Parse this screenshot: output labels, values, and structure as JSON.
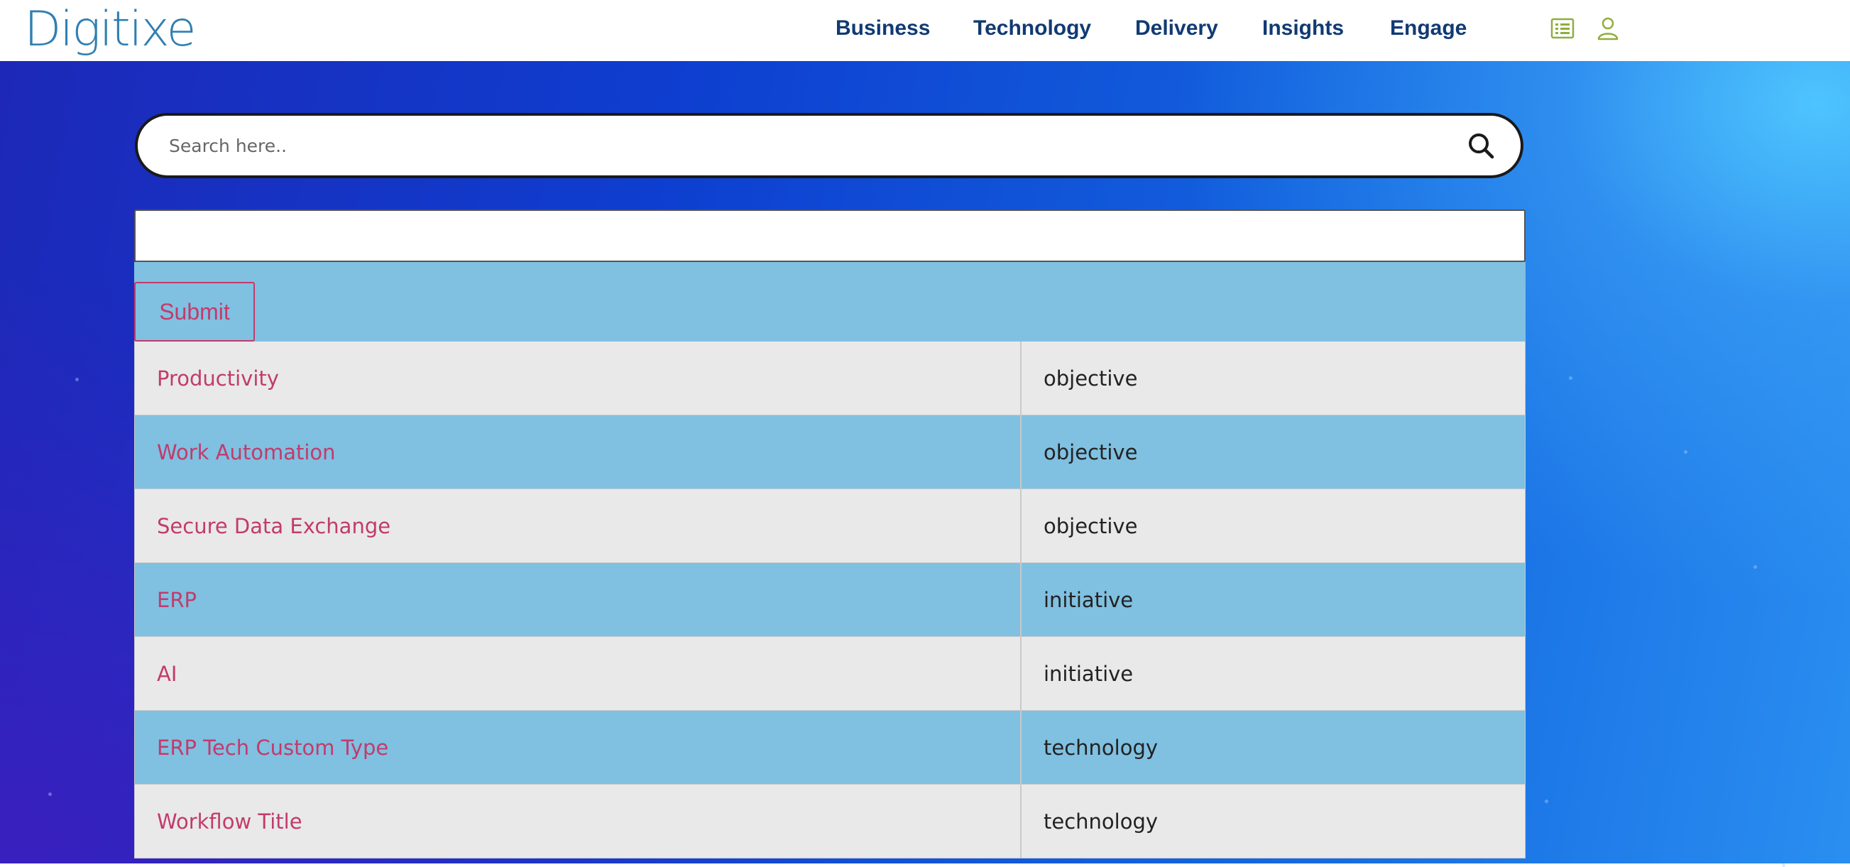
{
  "header": {
    "logo_text": "Digitixe",
    "nav": [
      {
        "label": "Business"
      },
      {
        "label": "Technology"
      },
      {
        "label": "Delivery"
      },
      {
        "label": "Insights"
      },
      {
        "label": "Engage"
      }
    ],
    "icons": [
      "list-icon",
      "user-icon"
    ],
    "icon_color": "#8fae3a",
    "nav_color": "#113a73"
  },
  "search": {
    "placeholder": "Search here..",
    "value": ""
  },
  "form": {
    "text_value": "",
    "submit_label": "Submit"
  },
  "results": [
    {
      "name": "Productivity",
      "type": "objective"
    },
    {
      "name": "Work Automation",
      "type": "objective"
    },
    {
      "name": "Secure Data Exchange",
      "type": "objective"
    },
    {
      "name": "ERP",
      "type": "initiative"
    },
    {
      "name": "AI",
      "type": "initiative"
    },
    {
      "name": "ERP Tech Custom Type",
      "type": "technology"
    },
    {
      "name": "Workflow Title",
      "type": "technology"
    }
  ],
  "colors": {
    "link": "#c23b6b",
    "row_alt": "#80c0e1",
    "row_base": "#e9e9e9"
  }
}
